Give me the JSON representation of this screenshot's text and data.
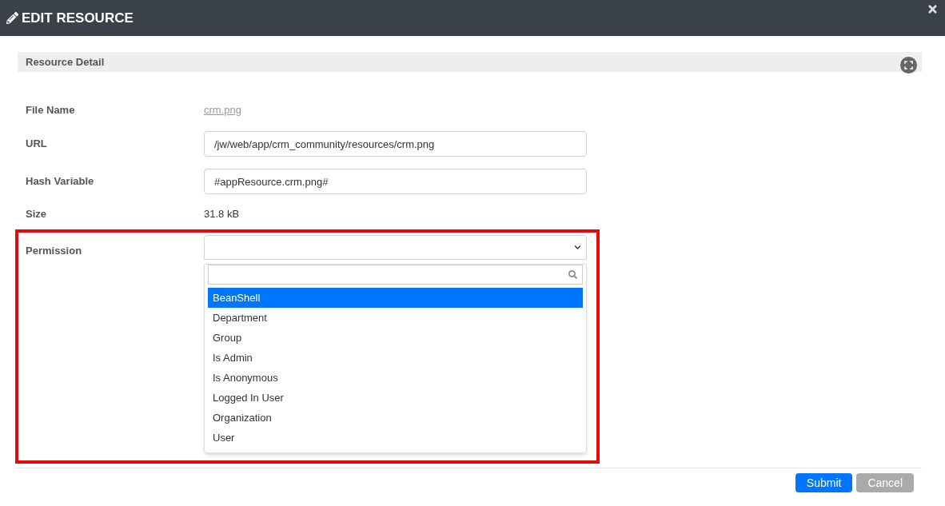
{
  "window": {
    "title": "EDIT RESOURCE"
  },
  "section": {
    "title": "Resource Detail"
  },
  "fields": [
    {
      "label": "File Name",
      "kind": "link",
      "value": "crm.png"
    },
    {
      "label": "URL",
      "kind": "input",
      "value": "/jw/web/app/crm_community/resources/crm.png"
    },
    {
      "label": "Hash Variable",
      "kind": "input",
      "value": "#appResource.crm.png#"
    },
    {
      "label": "Size",
      "kind": "text",
      "value": "31.8 kB"
    }
  ],
  "permission": {
    "label": "Permission",
    "expanded": true,
    "options": [
      {
        "label": "BeanShell",
        "selected": true
      },
      {
        "label": "Department",
        "selected": false
      },
      {
        "label": "Group",
        "selected": false
      },
      {
        "label": "Is Admin",
        "selected": false
      },
      {
        "label": "Is Anonymous",
        "selected": false
      },
      {
        "label": "Logged In User",
        "selected": false
      },
      {
        "label": "Organization",
        "selected": false
      },
      {
        "label": "User",
        "selected": false
      }
    ]
  },
  "buttons": [
    {
      "label": "Submit",
      "kind": "primary"
    },
    {
      "label": "Cancel",
      "kind": "secondary"
    }
  ]
}
